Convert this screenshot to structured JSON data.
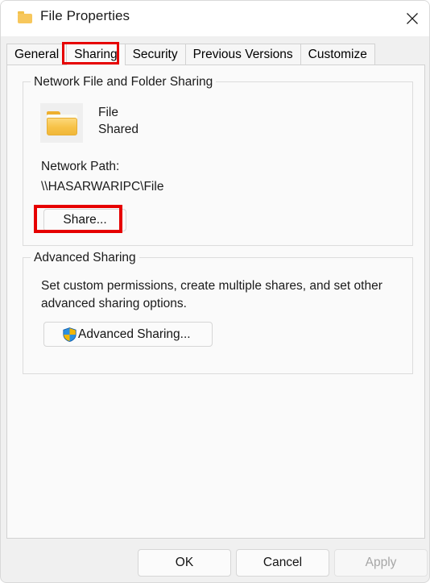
{
  "window": {
    "title": "File Properties",
    "icon": "folder-icon",
    "close_label": "✕"
  },
  "tabs": [
    {
      "label": "General",
      "selected": false
    },
    {
      "label": "Sharing",
      "selected": true
    },
    {
      "label": "Security",
      "selected": false
    },
    {
      "label": "Previous Versions",
      "selected": false
    },
    {
      "label": "Customize",
      "selected": false
    }
  ],
  "annotations": {
    "color": "#e60000",
    "targets": [
      "sharing-tab",
      "share-button"
    ]
  },
  "network_group": {
    "legend": "Network File and Folder Sharing",
    "folder_icon": "folder-icon",
    "share_name": "File",
    "share_state": "Shared",
    "network_path_label": "Network Path:",
    "network_path_value": "\\\\HASARWARIPC\\File",
    "share_button": "Share..."
  },
  "advanced_group": {
    "legend": "Advanced Sharing",
    "description": "Set custom permissions, create multiple shares, and set other advanced sharing options.",
    "advanced_button": "Advanced Sharing...",
    "advanced_button_icon": "uac-shield-icon"
  },
  "footer": {
    "ok": "OK",
    "cancel": "Cancel",
    "apply": "Apply",
    "apply_disabled": true
  }
}
